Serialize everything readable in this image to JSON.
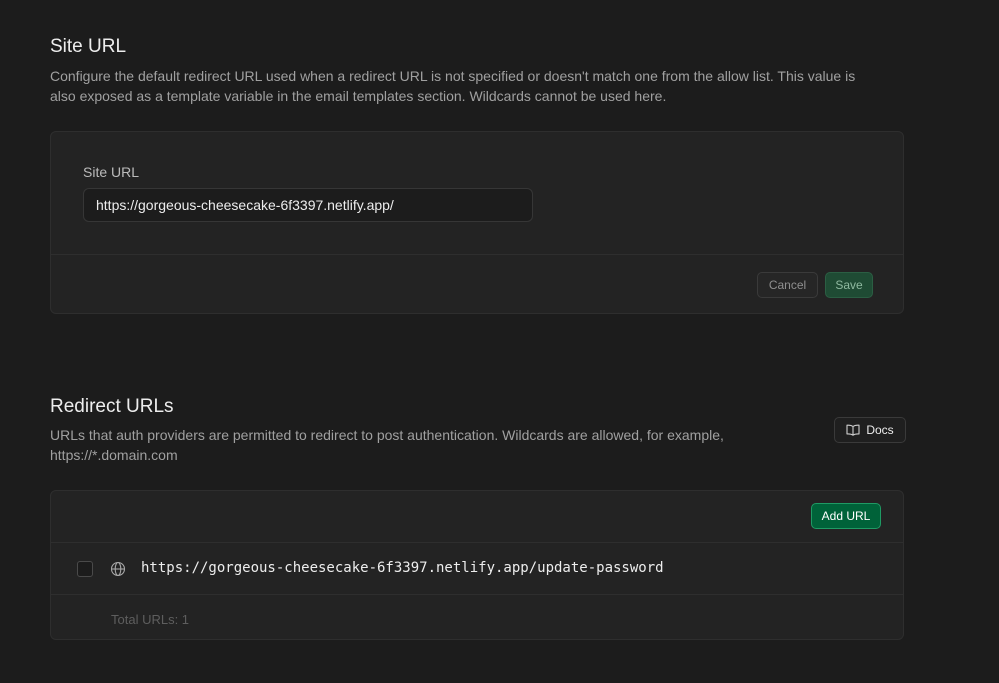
{
  "site_url": {
    "title": "Site URL",
    "description_line1": "Configure the default redirect URL used when a redirect URL is not specified or doesn't match one from the allow list. This value is",
    "description_line2": "also exposed as a template variable in the email templates section. Wildcards cannot be used here.",
    "field_label": "Site URL",
    "field_value": "https://gorgeous-cheesecake-6f3397.netlify.app/",
    "cancel_label": "Cancel",
    "save_label": "Save"
  },
  "redirect_urls": {
    "title": "Redirect URLs",
    "description_line1": "URLs that auth providers are permitted to redirect to post authentication. Wildcards are allowed, for example,",
    "description_line2": "https://*.domain.com",
    "docs_label": "Docs",
    "add_url_label": "Add URL",
    "urls": [
      "https://gorgeous-cheesecake-6f3397.netlify.app/update-password"
    ],
    "total_label": "Total URLs: 1"
  },
  "icons": {
    "docs": "book-open-icon",
    "url_row": "globe-icon"
  },
  "colors": {
    "accent_green": "#006239",
    "save_disabled": "#1f4b34",
    "background": "#1c1c1c"
  }
}
